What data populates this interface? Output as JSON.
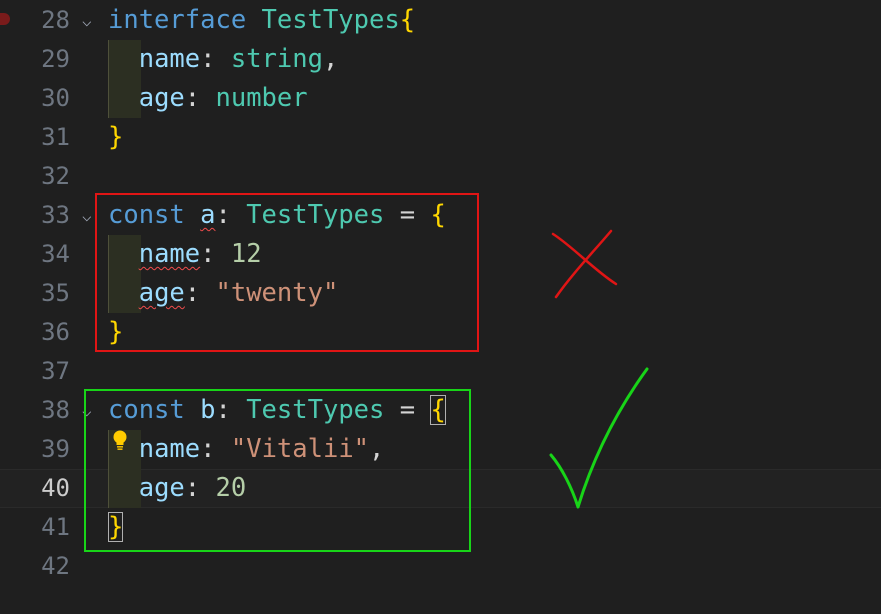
{
  "editor": {
    "lines": [
      {
        "number": "28",
        "text": "interface TestTypes{"
      },
      {
        "number": "29",
        "text": "name: string,"
      },
      {
        "number": "30",
        "text": "age: number"
      },
      {
        "number": "31",
        "text": "}"
      },
      {
        "number": "32",
        "text": ""
      },
      {
        "number": "33",
        "text": "const a: TestTypes = {"
      },
      {
        "number": "34",
        "text": "name: 12"
      },
      {
        "number": "35",
        "text": "age: \"twenty\""
      },
      {
        "number": "36",
        "text": "}"
      },
      {
        "number": "37",
        "text": ""
      },
      {
        "number": "38",
        "text": "const b: TestTypes = {"
      },
      {
        "number": "39",
        "text": "name: \"Vitalii\","
      },
      {
        "number": "40",
        "text": "age: 20"
      },
      {
        "number": "41",
        "text": "}"
      },
      {
        "number": "42",
        "text": ""
      }
    ],
    "current_line": "40",
    "fold_icon": "chevron-down-icon",
    "lightbulb_icon": "lightbulb-icon"
  },
  "annotations": {
    "invalid_mark": "cross-icon",
    "valid_mark": "checkmark-icon"
  },
  "colors": {
    "background": "#1f1f1f",
    "keyword": "#569cd6",
    "type": "#4ec9b0",
    "property": "#9cdcfe",
    "string": "#ce9178",
    "number": "#b5cea8",
    "brace": "#ffd700",
    "error_box": "#e01515",
    "success_box": "#18d418"
  }
}
